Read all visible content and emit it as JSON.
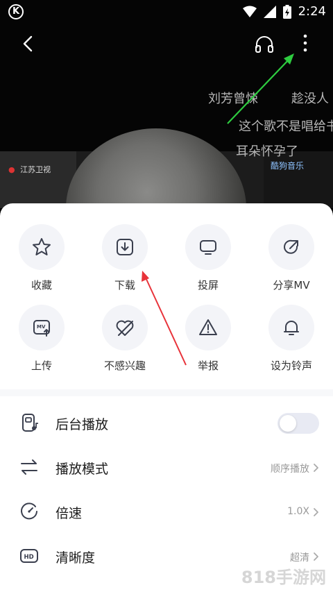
{
  "status_bar": {
    "logo": "K",
    "time": "2:24"
  },
  "video": {
    "danmu": [
      "刘芳曾悚",
      "趁没人",
      "这个歌不是唱给书",
      "耳朵怀孕了"
    ],
    "tv_logo": "江苏卫视",
    "music_logo": "酷狗音乐"
  },
  "actions": [
    {
      "label": "收藏",
      "icon": "star-icon"
    },
    {
      "label": "下载",
      "icon": "download-icon"
    },
    {
      "label": "投屏",
      "icon": "cast-screen-icon"
    },
    {
      "label": "分享MV",
      "icon": "share-icon"
    },
    {
      "label": "上传",
      "icon": "mv-upload-icon"
    },
    {
      "label": "不感兴趣",
      "icon": "not-interested-icon"
    },
    {
      "label": "举报",
      "icon": "report-warning-icon"
    },
    {
      "label": "设为铃声",
      "icon": "bell-icon"
    }
  ],
  "settings": [
    {
      "label": "后台播放",
      "icon": "background-play-icon",
      "toggle_on": false
    },
    {
      "label": "播放模式",
      "icon": "play-mode-icon",
      "value": "顺序播放"
    },
    {
      "label": "倍速",
      "icon": "speed-icon",
      "value": "1.0X"
    },
    {
      "label": "清晰度",
      "icon": "hd-icon",
      "value": "超清"
    }
  ],
  "watermark": "818手游网",
  "colors": {
    "arrow_green": "#2ecc40",
    "arrow_red": "#e8333a",
    "toggle_track": "#e8eaf3",
    "icon_stroke": "#3a3f4e"
  }
}
